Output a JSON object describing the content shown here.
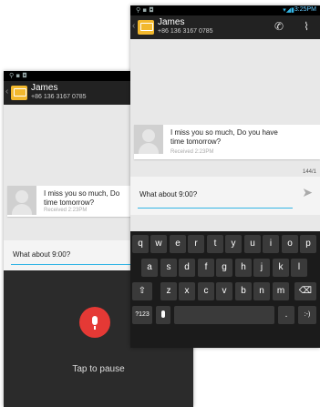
{
  "back_screen": {
    "contact": {
      "name": "James",
      "number": "+86 136 3167 0785"
    },
    "message": {
      "text_line1": "I miss you so much, Do",
      "text_line2": "time tomorrow?",
      "received": "Received 2:23PM"
    },
    "compose_value": "What about 9:00?",
    "voice": {
      "hint": "Tap to pause"
    }
  },
  "front_screen": {
    "status": {
      "time": "3:25PM"
    },
    "contact": {
      "name": "James",
      "number": "+86 136 3167 0785"
    },
    "message": {
      "text_line1": "I miss you so much, Do you have",
      "text_line2": "time tomorrow?",
      "received": "Received 2:23PM"
    },
    "counter": "144/1",
    "compose_value": "What about 9:00?",
    "keyboard": {
      "row1": [
        "q",
        "w",
        "e",
        "r",
        "t",
        "y",
        "u",
        "i",
        "o",
        "p"
      ],
      "row2": [
        "a",
        "s",
        "d",
        "f",
        "g",
        "h",
        "j",
        "k",
        "l"
      ],
      "row3": [
        "z",
        "x",
        "c",
        "v",
        "b",
        "n",
        "m"
      ],
      "shift": "⇧",
      "backspace": "⌫",
      "symbols": "?123",
      "period": ".",
      "smiley": ":-)"
    }
  },
  "colors": {
    "accent": "#33b5e5",
    "mic": "#e53935",
    "contact_badge": "#f2b82d"
  },
  "icons": [
    "wifi-icon",
    "signal-icon",
    "up-icon",
    "contact-icon",
    "phone-icon",
    "attach-icon",
    "send-icon",
    "mic-icon",
    "shift-icon",
    "backspace-icon"
  ]
}
